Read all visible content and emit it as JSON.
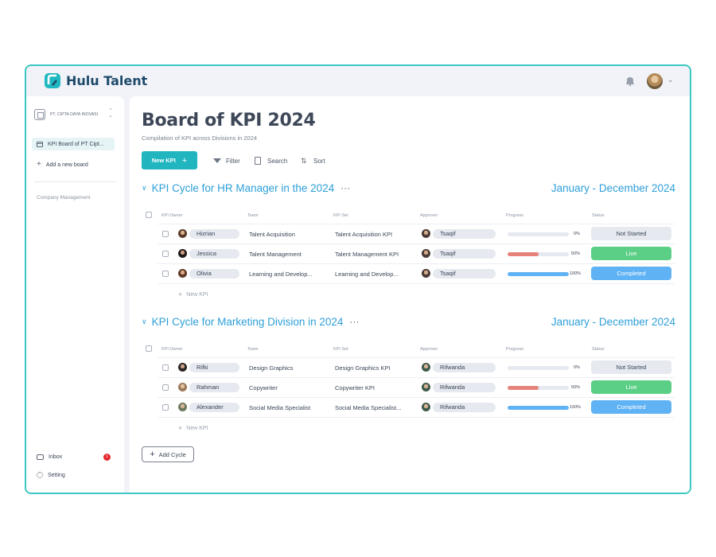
{
  "app": {
    "name": "Hulu Talent"
  },
  "colors": {
    "accent": "#20b5bf",
    "link": "#2d9fd8",
    "live": "#5ccf87",
    "completed": "#5fb2f4",
    "progress_mid": "#e5837a",
    "progress_full": "#5fb2f4",
    "badge": "#e5272d"
  },
  "sidebar": {
    "org_name": "PT. CIPTA DAYA INOVASI",
    "board_label": "KPI Board of PT Cipt...",
    "add_board_label": "Add a new board",
    "section_label": "Company Management",
    "inbox_label": "Inbox",
    "inbox_count": "1",
    "setting_label": "Setting"
  },
  "main": {
    "title": "Board of KPI 2024",
    "subtitle": "Compilation of KPI across Divisions in 2024",
    "toolbar": {
      "new_kpi": "New KPI",
      "filter": "Filter",
      "search": "Search",
      "sort": "Sort"
    },
    "columns": {
      "owner": "KPI Owner",
      "team": "Team",
      "kpi_set": "KPI Set",
      "approver": "Approver",
      "progress": "Progress",
      "status": "Status"
    },
    "add_kpi_label": "New KPI",
    "add_cycle_label": "Add Cycle",
    "cycles": [
      {
        "title": "KPI Cycle for HR Manager in the 2024",
        "range": "January - December 2024",
        "rows": [
          {
            "owner": "Hizrian",
            "team": "Talent Acquisition",
            "kpi_set": "Talent Acquisition KPI",
            "approver": "Tsaqif",
            "progress": 0,
            "progress_label": "0%",
            "status": "Not Started",
            "status_kind": "ns"
          },
          {
            "owner": "Jessica",
            "team": "Talent Management",
            "kpi_set": "Talent Management KPI",
            "approver": "Tsaqif",
            "progress": 50,
            "progress_label": "50%",
            "status": "Live",
            "status_kind": "live"
          },
          {
            "owner": "Olivia",
            "team": "Learning and Develop...",
            "kpi_set": "Learning and Develop...",
            "approver": "Tsaqif",
            "progress": 100,
            "progress_label": "100%",
            "status": "Completed",
            "status_kind": "done"
          }
        ]
      },
      {
        "title": "KPI Cycle for Marketing Division in 2024",
        "range": "January - December 2024",
        "rows": [
          {
            "owner": "Rifki",
            "team": "Design Graphics",
            "kpi_set": "Design Graphics KPI",
            "approver": "Rifwanda",
            "progress": 0,
            "progress_label": "0%",
            "status": "Not Started",
            "status_kind": "ns"
          },
          {
            "owner": "Rahman",
            "team": "Copywriter",
            "kpi_set": "Copywriter KPI",
            "approver": "Rifwanda",
            "progress": 50,
            "progress_label": "50%",
            "status": "Live",
            "status_kind": "live"
          },
          {
            "owner": "Alexander",
            "team": "Social Media Specialist",
            "kpi_set": "Social Media Specialist...",
            "approver": "Rifwanda",
            "progress": 100,
            "progress_label": "100%",
            "status": "Completed",
            "status_kind": "done"
          }
        ]
      }
    ]
  }
}
